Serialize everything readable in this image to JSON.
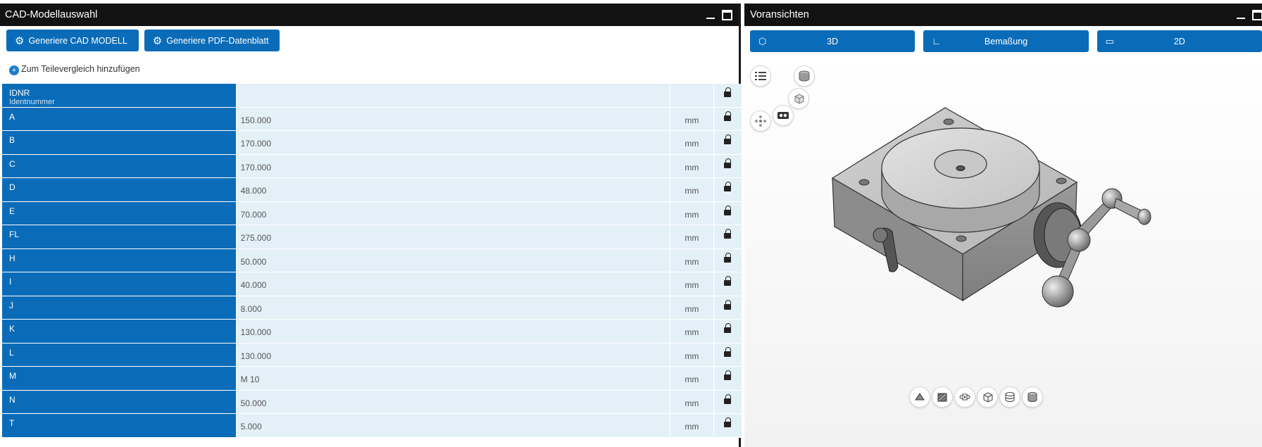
{
  "left_panel": {
    "title": "CAD-Modellauswahl",
    "buttons": {
      "generate_cad": "Generiere CAD MODELL",
      "generate_pdf": "Generiere PDF-Datenblatt"
    },
    "compare_link": "Zum Teilevergleich hinzufügen",
    "params": [
      {
        "name": "IDNR",
        "sub": "Identnummer",
        "value": "",
        "unit": ""
      },
      {
        "name": "A",
        "value": "150.000",
        "unit": "mm"
      },
      {
        "name": "B",
        "value": "170.000",
        "unit": "mm"
      },
      {
        "name": "C",
        "value": "170.000",
        "unit": "mm"
      },
      {
        "name": "D",
        "value": "48.000",
        "unit": "mm"
      },
      {
        "name": "E",
        "value": "70.000",
        "unit": "mm"
      },
      {
        "name": "FL",
        "value": "275.000",
        "unit": "mm"
      },
      {
        "name": "H",
        "value": "50.000",
        "unit": "mm"
      },
      {
        "name": "I",
        "value": "40.000",
        "unit": "mm"
      },
      {
        "name": "J",
        "value": "8.000",
        "unit": "mm"
      },
      {
        "name": "K",
        "value": "130.000",
        "unit": "mm"
      },
      {
        "name": "L",
        "value": "130.000",
        "unit": "mm"
      },
      {
        "name": "M",
        "value": "M 10",
        "unit": "mm"
      },
      {
        "name": "N",
        "value": "50.000",
        "unit": "mm"
      },
      {
        "name": "T",
        "value": "5.000",
        "unit": "mm"
      }
    ]
  },
  "right_panel": {
    "title": "Voransichten",
    "tabs": [
      {
        "label": "3D",
        "icon": "cube-icon"
      },
      {
        "label": "Bemaßung",
        "icon": "dimension-icon"
      },
      {
        "label": "2D",
        "icon": "2d-view-icon"
      }
    ]
  },
  "colors": {
    "accent": "#0a6cb8",
    "header_bg": "#121212",
    "row_bg": "#e3f0f7"
  }
}
